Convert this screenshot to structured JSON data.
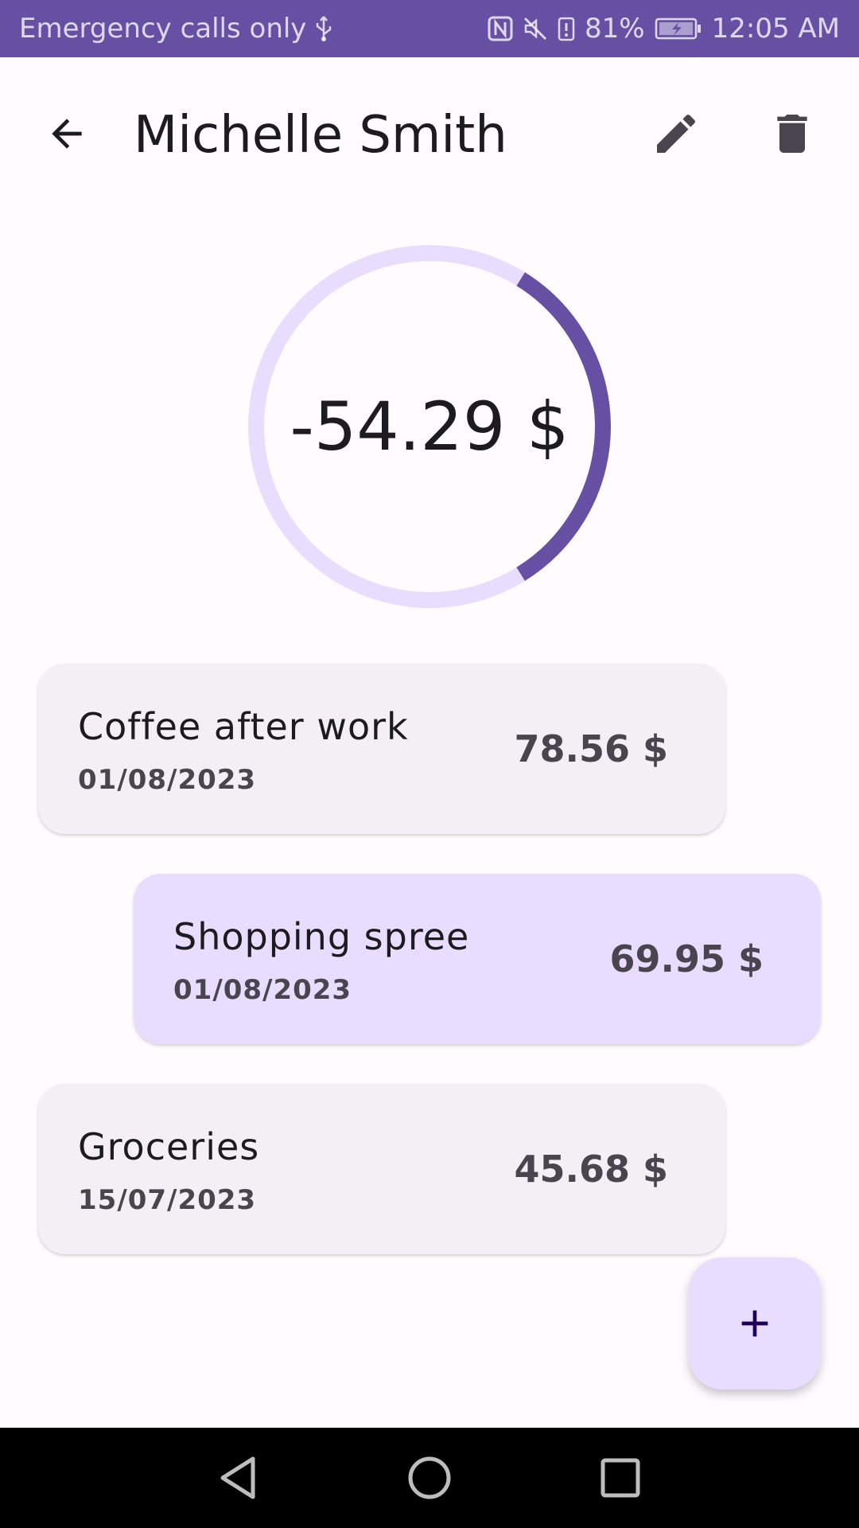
{
  "status_bar": {
    "carrier_text": "Emergency calls only",
    "battery_percent": "81%",
    "time": "12:05 AM",
    "icons": [
      "usb-icon",
      "nfc-icon",
      "mute-icon",
      "battery-alert-icon",
      "battery-charging-icon"
    ]
  },
  "header": {
    "title": "Michelle Smith",
    "icons": [
      "back-arrow-icon",
      "edit-pencil-icon",
      "delete-trash-icon"
    ]
  },
  "balance": {
    "value": "-54.29 $",
    "ring_fraction": 0.33,
    "colors": {
      "track": "#e9ddff",
      "progress": "#6750a4"
    }
  },
  "transactions": [
    {
      "description": "Coffee after work",
      "date": "01/08/2023",
      "amount": "78.56 $",
      "direction": "out"
    },
    {
      "description": "Shopping spree",
      "date": "01/08/2023",
      "amount": "69.95 $",
      "direction": "in"
    },
    {
      "description": "Groceries",
      "date": "15/07/2023",
      "amount": "45.68 $",
      "direction": "out"
    }
  ],
  "fab": {
    "icon": "plus-icon"
  },
  "nav": {
    "icons": [
      "nav-back-icon",
      "nav-home-icon",
      "nav-recents-icon"
    ]
  },
  "colors": {
    "primary": "#6750a4",
    "surface": "#fffbfe",
    "card_out": "#f4eff4",
    "card_in": "#e9ddff"
  }
}
